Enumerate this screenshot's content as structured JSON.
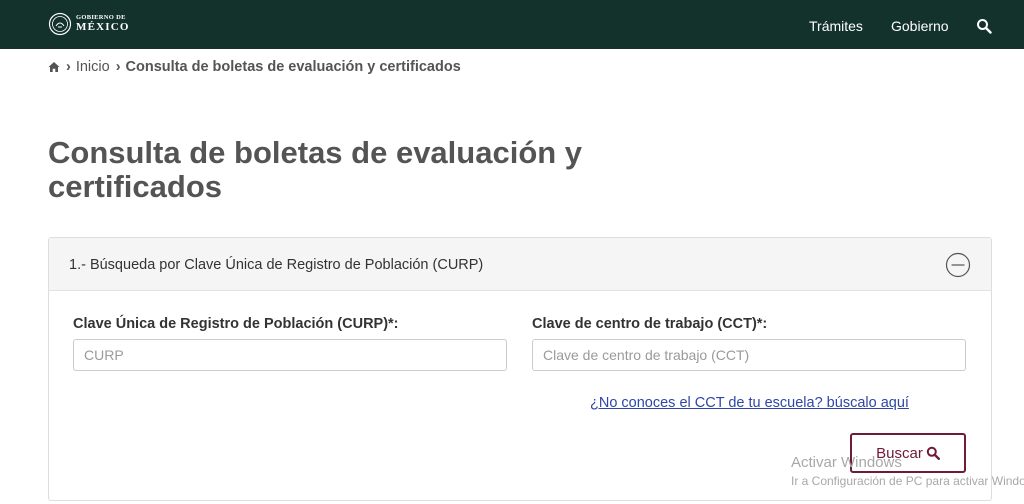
{
  "header": {
    "logo_top": "GOBIERNO DE",
    "logo_bottom": "MÉXICO",
    "nav": [
      {
        "label": "Trámites"
      },
      {
        "label": "Gobierno"
      }
    ],
    "search_icon": "search-icon",
    "background_color": "#13322b"
  },
  "breadcrumb": {
    "home_icon": "home-icon",
    "items": [
      {
        "label": "Inicio"
      },
      {
        "label": "Consulta de boletas de evaluación y certificados"
      }
    ]
  },
  "page": {
    "title": "Consulta de boletas de evaluación y certificados"
  },
  "panel": {
    "title": "1.- Búsqueda por Clave Única de Registro de Población (CURP)",
    "collapse_icon": "minus-circle-icon",
    "curp": {
      "label": "Clave Única de Registro de Población (CURP)*:",
      "placeholder": "CURP",
      "value": ""
    },
    "cct": {
      "label": "Clave de centro de trabajo (CCT)*:",
      "placeholder": "Clave de centro de trabajo (CCT)",
      "value": ""
    },
    "cct_help_link": "¿No conoces el CCT de tu escuela? búscalo aquí",
    "search_button": "Buscar",
    "accent_color": "#6f1a38"
  },
  "watermark": {
    "title": "Activar Windows",
    "subtitle": "Ir a Configuración de PC para activar Windows."
  }
}
